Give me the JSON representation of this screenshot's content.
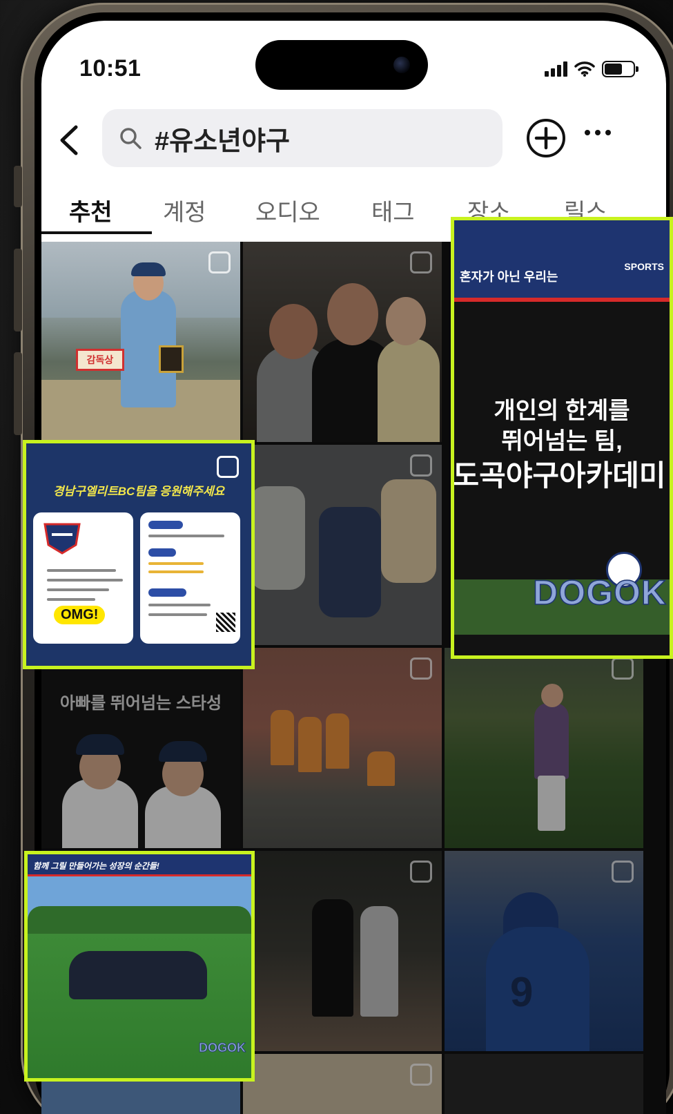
{
  "status_bar": {
    "time": "10:51"
  },
  "search": {
    "query": "#유소년야구"
  },
  "tabs": [
    {
      "label": "추천",
      "active": true
    },
    {
      "label": "계정",
      "active": false
    },
    {
      "label": "오디오",
      "active": false
    },
    {
      "label": "태그",
      "active": false
    },
    {
      "label": "장소",
      "active": false
    },
    {
      "label": "릴스",
      "active": false
    }
  ],
  "colors": {
    "highlight_border": "#c8f21f",
    "brand_navy": "#1e3470",
    "brand_red": "#d62a2a"
  },
  "icons": [
    "back-arrow-icon",
    "search-icon",
    "add-circle-icon",
    "more-horizontal-icon",
    "signal-icon",
    "wifi-icon",
    "battery-icon",
    "multi-image-icon"
  ],
  "posts": {
    "award": {
      "sign_text": "감독상"
    },
    "academy": {
      "banner_text": "혼자가 아닌 우리는",
      "brand_line1": "SPORTS",
      "line1": "개인의 한계를",
      "line2": "뛰어넘는 팀,",
      "line3": "도곡야구아카데미",
      "logo_text": "DOGOK"
    },
    "recruit": {
      "title": "경남구엘리트BC팀을 응원해주세요",
      "badge": "OMG!"
    },
    "kids": {
      "caption": "아빠를 뛰어넘는 스타성"
    },
    "team": {
      "banner_text": "함께 그릴 만들어가는 성장의 순간들!",
      "logo_text": "DOGOK"
    },
    "fans": {
      "jersey_number": "9"
    }
  }
}
